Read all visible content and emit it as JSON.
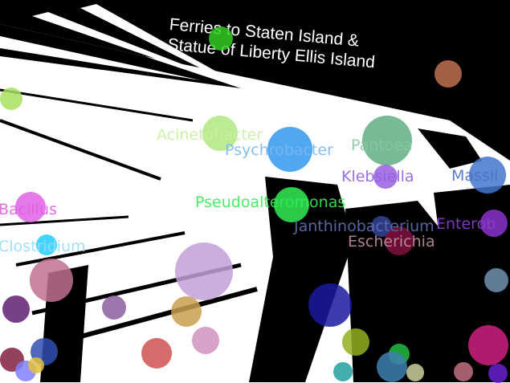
{
  "sign": {
    "line1": "Ferries to Staten Island &",
    "line2": "Statue of Liberty  Ellis Island"
  },
  "labels": [
    {
      "text": "Acinetobacter",
      "color": "#c8f0a0"
    },
    {
      "text": "Psychrobacter",
      "color": "#7ab8f0"
    },
    {
      "text": "Pantoea",
      "color": "#8ac8a0"
    },
    {
      "text": "Klebsiella",
      "color": "#9060e0"
    },
    {
      "text": "Massil",
      "color": "#4a70c8"
    },
    {
      "text": "Bacillus",
      "color": "#e060e0"
    },
    {
      "text": "Pseudoalteromonas",
      "color": "#33ee55"
    },
    {
      "text": "Janthinobacterium",
      "color": "#6070b0"
    },
    {
      "text": "Enterob",
      "color": "#8a40cc"
    },
    {
      "text": "Escherichia",
      "color": "#c090a0"
    },
    {
      "text": "Clostridium",
      "color": "#99ddf5"
    }
  ],
  "bubble_colors": [
    "#33cc22",
    "#c0704f",
    "#a8e060",
    "#b0e880",
    "#3399ee",
    "#5fae80",
    "#9a5fe0",
    "#4477cc",
    "#e060e8",
    "#33ee55",
    "#334499",
    "#801040",
    "#8833cc",
    "#22ccff",
    "#c07090",
    "#c0a0d8",
    "#7090b0",
    "#602070",
    "#8a5fa0",
    "#c8a050",
    "#1a1aa0",
    "#d090c0",
    "#d05050",
    "#90b020",
    "#22bb44",
    "#d02080",
    "#3050b0",
    "#802040",
    "#4080b0",
    "#22a0a0",
    "#d0d0a0",
    "#c07080",
    "#8080ff",
    "#e0c040",
    "#6a20d0"
  ]
}
